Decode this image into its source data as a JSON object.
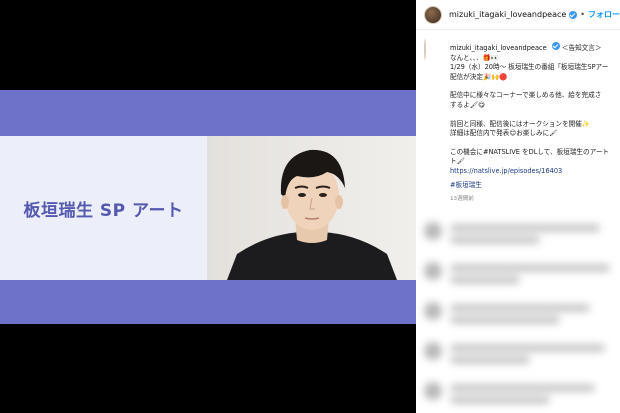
{
  "media": {
    "title": "板垣瑞生 SP アート",
    "colors": {
      "band": "#6e72c9",
      "title_bg": "#eceefa",
      "title_text": "#5459b0"
    }
  },
  "header": {
    "username": "mizuki_itagaki_loveandpeace",
    "separator": "•",
    "follow_label": "フォロー"
  },
  "caption": {
    "username": "mizuki_itagaki_loveandpeace",
    "lines": [
      "＜告知文言＞",
      "なんと、、、🎁👀",
      "1/29（水）20時〜 板垣瑞生の番組「板垣瑞生SPアー",
      "配信が決定🎉🙌🔴",
      "",
      "配信中に様々なコーナーで楽しめる他、絵を完成さ",
      "するよ🖌😋",
      "",
      "前回と同様、配信後にはオークションを開催✨",
      "詳細は配信内で発表😊お楽しみに🖌",
      "",
      "この機会に#NATSLIVE をDLして、板垣瑞生のアート",
      "ト🖌"
    ],
    "link": "https://natslive.jp/episodes/16403",
    "hashtag": "#板垣瑞生",
    "time_ago": "13週間前"
  },
  "icons": {
    "avatar": "avatar",
    "verified": "verified-badge-icon"
  }
}
